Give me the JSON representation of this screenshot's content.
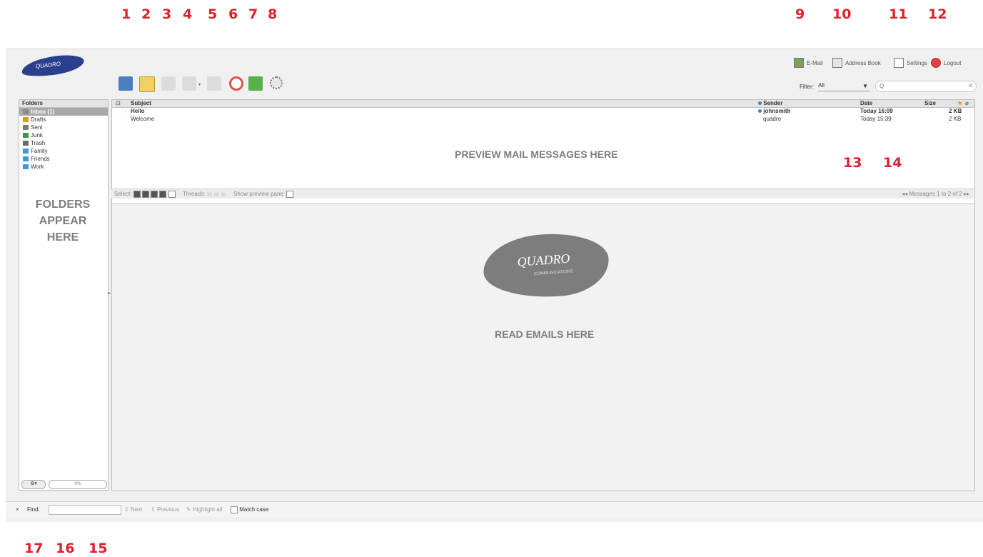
{
  "callouts": {
    "n1": "1",
    "n2": "2",
    "n3": "3",
    "n4": "4",
    "n5": "5",
    "n6": "6",
    "n7": "7",
    "n8": "8",
    "n9": "9",
    "n10": "10",
    "n11": "11",
    "n12": "12",
    "n13": "13",
    "n14": "14",
    "n15": "15",
    "n16": "16",
    "n17": "17"
  },
  "logo": {
    "text": "QUADRO"
  },
  "top_nav": {
    "email": "E-Mail",
    "address_book": "Address Book",
    "settings": "Settings",
    "logout": "Logout"
  },
  "toolbar_icons": [
    "get-mail-icon",
    "compose-icon",
    "reply-icon",
    "reply-all-icon",
    "forward-icon",
    "delete-icon",
    "mark-spam-icon",
    "more-options-icon"
  ],
  "filter": {
    "label": "Filter:",
    "value": "All"
  },
  "search": {
    "placeholder": "Q·",
    "clear": "⊘"
  },
  "folders": {
    "header": "Folders",
    "items": [
      {
        "label": "Inbox (1)",
        "selected": true,
        "color": "#8a8a8a"
      },
      {
        "label": "Drafts",
        "color": "#d4a017"
      },
      {
        "label": "Sent",
        "color": "#7a7a7a"
      },
      {
        "label": "Junk",
        "color": "#3f9a3f"
      },
      {
        "label": "Trash",
        "color": "#6a6a6a"
      },
      {
        "label": "Family",
        "color": "#3a9ad9"
      },
      {
        "label": "Friends",
        "color": "#3a9ad9"
      },
      {
        "label": "Work",
        "color": "#3a9ad9"
      }
    ],
    "overlay": [
      "FOLDERS",
      "APPEAR",
      "HERE"
    ]
  },
  "message_list": {
    "columns": {
      "subject": "Subject",
      "sender": "Sender",
      "date": "Date",
      "size": "Size"
    },
    "rows": [
      {
        "subject": "Hello",
        "sender": "johnsmith",
        "date": "Today 16:09",
        "size": "2 KB",
        "unread": true
      },
      {
        "subject": "Welcome",
        "sender": "quadro",
        "date": "Today 15:39",
        "size": "2 KB",
        "unread": false
      }
    ],
    "overlay": "PREVIEW MAIL MESSAGES HERE"
  },
  "list_footer": {
    "select_label": "Select:",
    "threads_label": "Threads:",
    "preview_label": "Show preview pane:",
    "paging": "Messages 1 to 2 of 2"
  },
  "preview_pane": {
    "watermark": "QUADRO",
    "watermark_sub": "COMMUNICATIONS",
    "overlay": "READ EMAILS HERE"
  },
  "status": {
    "quota": "0%"
  },
  "find_bar": {
    "close": "×",
    "label": "Find:",
    "next": "Next",
    "previous": "Previous",
    "highlight": "Highlight all",
    "match_case": "Match case"
  },
  "colors": {
    "callout": "#e0202a",
    "accent": "#2b3f8f"
  }
}
